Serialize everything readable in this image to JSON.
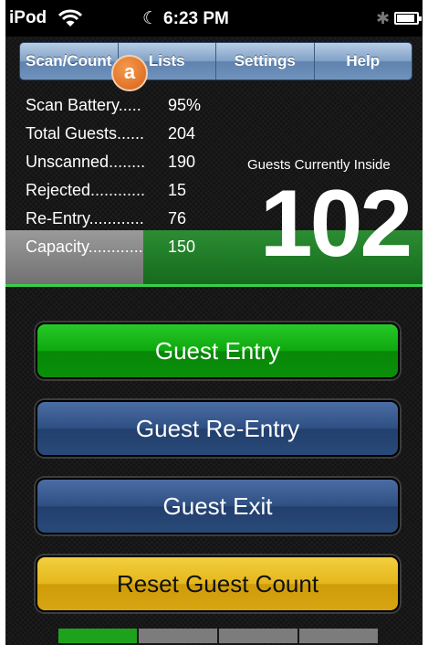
{
  "status_bar": {
    "carrier": "iPod",
    "time": "6:23 PM",
    "icons": [
      "wifi-icon",
      "moon-icon",
      "bluetooth-icon",
      "battery-icon"
    ],
    "battery_level": 0.9
  },
  "tabs": [
    {
      "label": "Scan/Count"
    },
    {
      "label": "Lists"
    },
    {
      "label": "Settings"
    },
    {
      "label": "Help"
    }
  ],
  "marker": {
    "label": "a"
  },
  "stats": [
    {
      "label": "Scan Battery.....",
      "value": "95%"
    },
    {
      "label": "Total Guests......",
      "value": "204"
    },
    {
      "label": "Unscanned........",
      "value": "190"
    },
    {
      "label": "Rejected............",
      "value": "15"
    },
    {
      "label": "Re-Entry............",
      "value": "76"
    },
    {
      "label": "Capacity............",
      "value": "150"
    }
  ],
  "inside": {
    "label": "Guests Currently Inside",
    "count": "102",
    "capacity_fill": 0.33
  },
  "buttons": {
    "entry": "Guest Entry",
    "reentry": "Guest Re-Entry",
    "exit": "Guest Exit",
    "reset": "Reset Guest Count"
  },
  "colors": {
    "entry": "#0ea80e",
    "reentry": "#2e4f82",
    "exit": "#2e4f82",
    "reset": "#e4b61c",
    "tab_bar": "#7fa0c6"
  },
  "page_indicator": {
    "pages": 4,
    "active": 0
  }
}
